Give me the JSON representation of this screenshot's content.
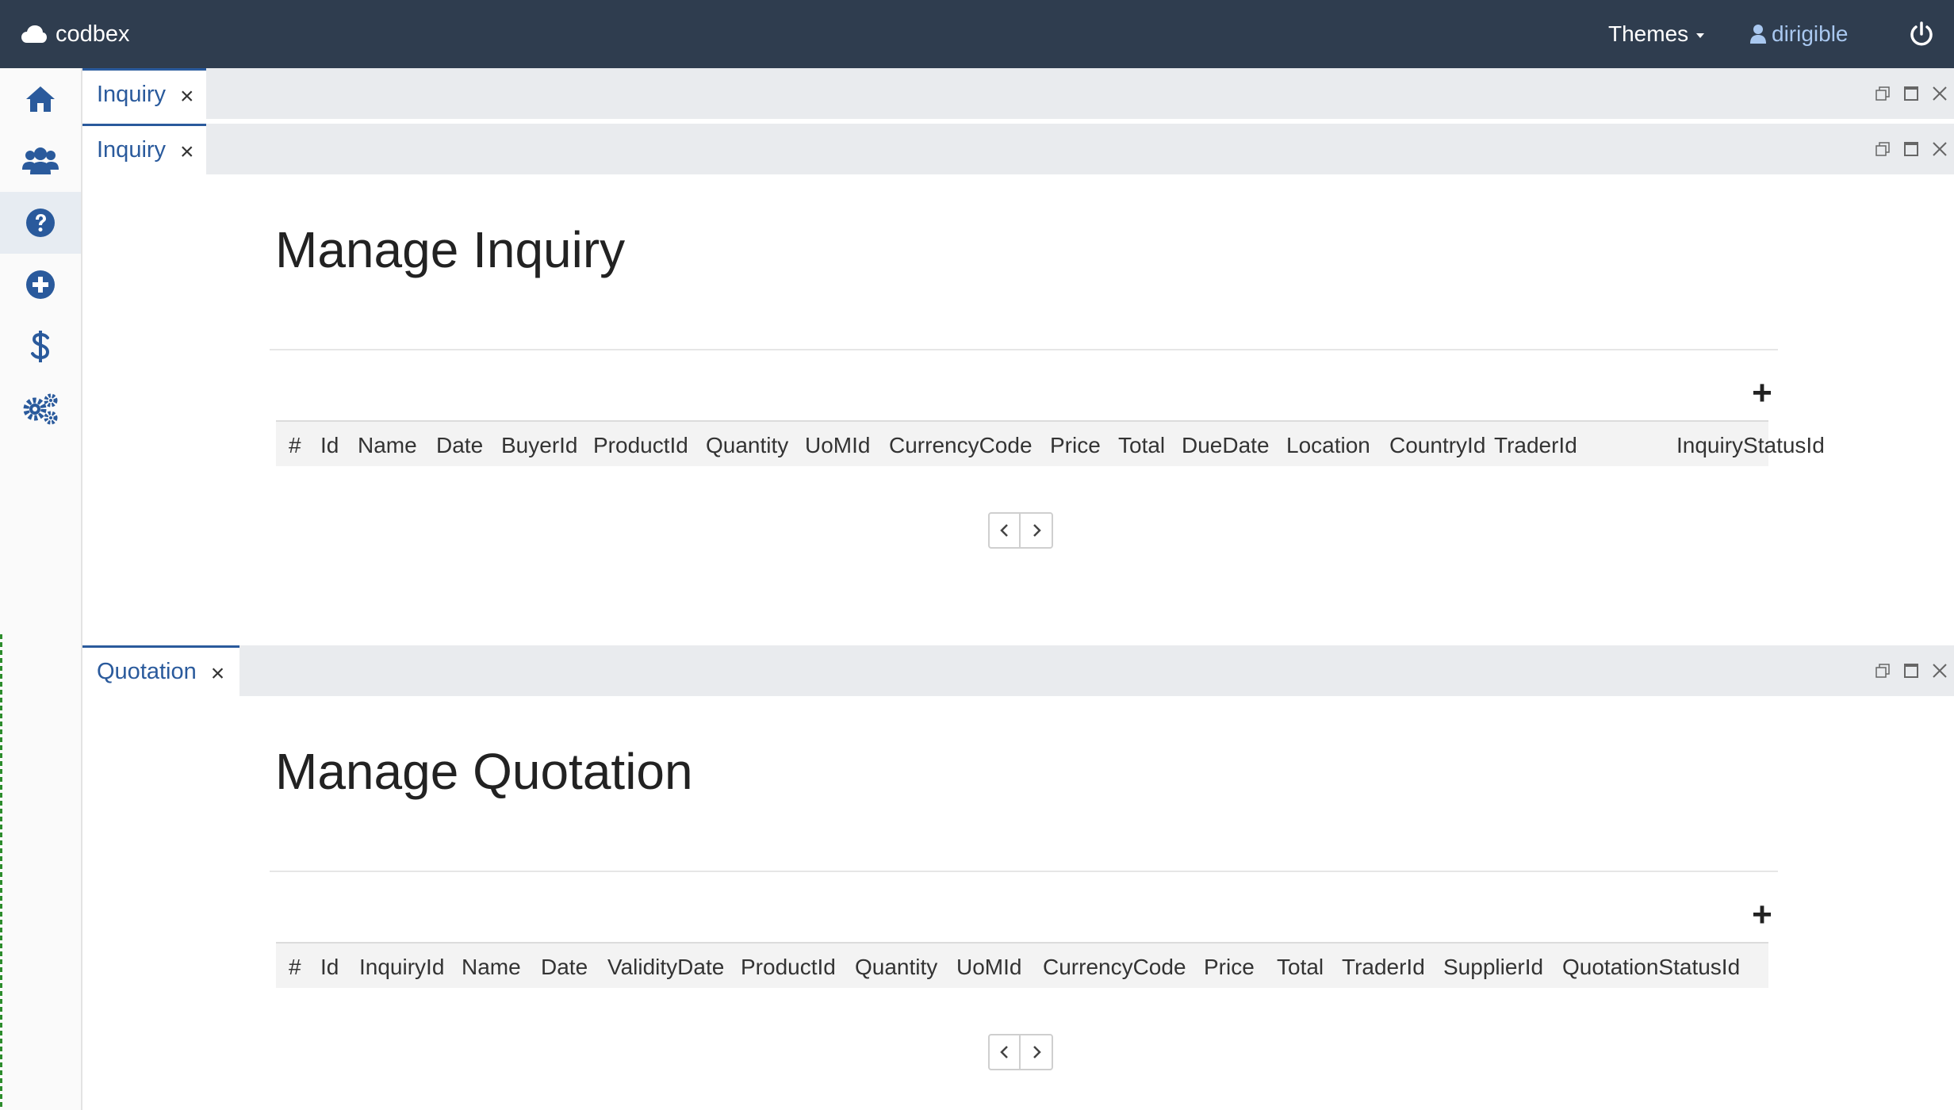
{
  "header": {
    "brand": "codbex",
    "themes_label": "Themes",
    "user_name": "dirigible",
    "icons": [
      "cloud-icon",
      "user-icon",
      "power-icon"
    ]
  },
  "sidebar": {
    "items": [
      {
        "name": "home",
        "icon": "home-icon"
      },
      {
        "name": "users",
        "icon": "users-icon"
      },
      {
        "name": "inquiry",
        "icon": "question-circle-icon",
        "active": true
      },
      {
        "name": "add",
        "icon": "plus-circle-icon"
      },
      {
        "name": "finance",
        "icon": "dollar-icon"
      },
      {
        "name": "settings",
        "icon": "cogs-icon"
      }
    ]
  },
  "outer_tab": {
    "label": "Inquiry",
    "close": "×"
  },
  "inquiry": {
    "tab_label": "Inquiry",
    "tab_close": "×",
    "title": "Manage Inquiry",
    "add_label": "+",
    "columns": [
      "#",
      "Id",
      "Name",
      "Date",
      "BuyerId",
      "ProductId",
      "Quantity",
      "UoMId",
      "CurrencyCode",
      "Price",
      "Total",
      "DueDate",
      "Location",
      "CountryId",
      "TraderId",
      "InquiryStatusId"
    ]
  },
  "quotation": {
    "tab_label": "Quotation",
    "tab_close": "×",
    "title": "Manage Quotation",
    "add_label": "+",
    "columns": [
      "#",
      "Id",
      "InquiryId",
      "Name",
      "Date",
      "ValidityDate",
      "ProductId",
      "Quantity",
      "UoMId",
      "CurrencyCode",
      "Price",
      "Total",
      "TraderId",
      "SupplierId",
      "QuotationStatusId"
    ]
  },
  "colors": {
    "topbar": "#2f3d4f",
    "accent": "#2a5a9c",
    "user_link": "#a9c8f0",
    "tabbar": "#e9ebee"
  }
}
